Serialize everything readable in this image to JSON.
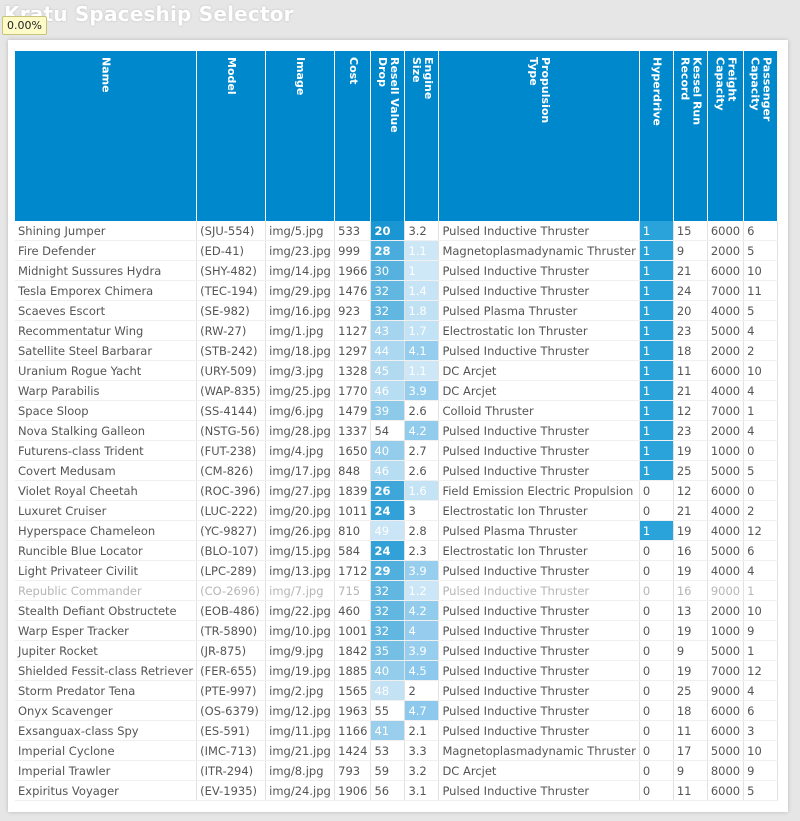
{
  "page": {
    "title": "Kratu Spaceship Selector",
    "progress": "0.00%"
  },
  "columns": [
    "Name",
    "Model",
    "Image",
    "Cost",
    "Resell Value\nDrop",
    "Engine\nSize",
    "Propulsion\nType",
    "Hyperdrive",
    "Kessel Run\nRecord",
    "Freight\nCapacity",
    "Passenger\nCapacity"
  ],
  "colors": {
    "header": "#0088cc",
    "heat_high": "#1a96d2",
    "heat_low": "#cfe8f7"
  },
  "rows": [
    [
      "Shining Jumper",
      "(SJU-554)",
      "img/5.jpg",
      "533",
      "20",
      "3.2",
      "Pulsed Inductive Thruster",
      "1",
      "15",
      "6000",
      "6"
    ],
    [
      "Fire Defender",
      "(ED-41)",
      "img/23.jpg",
      "999",
      "28",
      "1.1",
      "Magnetoplasmadynamic Thruster",
      "1",
      "9",
      "2000",
      "5"
    ],
    [
      "Midnight Sussures Hydra",
      "(SHY-482)",
      "img/14.jpg",
      "1966",
      "30",
      "1",
      "Pulsed Inductive Thruster",
      "1",
      "21",
      "6000",
      "10"
    ],
    [
      "Tesla Emporex Chimera",
      "(TEC-194)",
      "img/29.jpg",
      "1476",
      "32",
      "1.4",
      "Pulsed Inductive Thruster",
      "1",
      "24",
      "7000",
      "11"
    ],
    [
      "Scaeves Escort",
      "(SE-982)",
      "img/16.jpg",
      "923",
      "32",
      "1.8",
      "Pulsed Plasma Thruster",
      "1",
      "20",
      "4000",
      "5"
    ],
    [
      "Recommentatur Wing",
      "(RW-27)",
      "img/1.jpg",
      "1127",
      "43",
      "1.7",
      "Electrostatic Ion Thruster",
      "1",
      "23",
      "5000",
      "4"
    ],
    [
      "Satellite Steel Barbarar",
      "(STB-242)",
      "img/18.jpg",
      "1297",
      "44",
      "4.1",
      "Pulsed Inductive Thruster",
      "1",
      "18",
      "2000",
      "2"
    ],
    [
      "Uranium Rogue Yacht",
      "(URY-509)",
      "img/3.jpg",
      "1328",
      "45",
      "1.1",
      "DC Arcjet",
      "1",
      "11",
      "6000",
      "10"
    ],
    [
      "Warp Parabilis",
      "(WAP-835)",
      "img/25.jpg",
      "1770",
      "46",
      "3.9",
      "DC Arcjet",
      "1",
      "21",
      "4000",
      "4"
    ],
    [
      "Space Sloop",
      "(SS-4144)",
      "img/6.jpg",
      "1479",
      "39",
      "2.6",
      "Colloid Thruster",
      "1",
      "12",
      "7000",
      "1"
    ],
    [
      "Nova Stalking Galleon",
      "(NSTG-56)",
      "img/28.jpg",
      "1337",
      "54",
      "4.2",
      "Pulsed Inductive Thruster",
      "1",
      "23",
      "2000",
      "4"
    ],
    [
      "Futurens-class Trident",
      "(FUT-238)",
      "img/4.jpg",
      "1650",
      "40",
      "2.7",
      "Pulsed Inductive Thruster",
      "1",
      "19",
      "1000",
      "0"
    ],
    [
      "Covert Medusam",
      "(CM-826)",
      "img/17.jpg",
      "848",
      "46",
      "2.6",
      "Pulsed Inductive Thruster",
      "1",
      "25",
      "5000",
      "5"
    ],
    [
      "Violet Royal Cheetah",
      "(ROC-396)",
      "img/27.jpg",
      "1839",
      "26",
      "1.6",
      "Field Emission Electric Propulsion",
      "0",
      "12",
      "6000",
      "0"
    ],
    [
      "Luxuret Cruiser",
      "(LUC-222)",
      "img/20.jpg",
      "1011",
      "24",
      "3",
      "Electrostatic Ion Thruster",
      "0",
      "21",
      "4000",
      "2"
    ],
    [
      "Hyperspace Chameleon",
      "(YC-9827)",
      "img/26.jpg",
      "810",
      "49",
      "2.8",
      "Pulsed Plasma Thruster",
      "1",
      "19",
      "4000",
      "12"
    ],
    [
      "Runcible Blue Locator",
      "(BLO-107)",
      "img/15.jpg",
      "584",
      "24",
      "2.3",
      "Electrostatic Ion Thruster",
      "0",
      "16",
      "5000",
      "6"
    ],
    [
      "Light Privateer Civilit",
      "(LPC-289)",
      "img/13.jpg",
      "1712",
      "29",
      "3.9",
      "Pulsed Inductive Thruster",
      "0",
      "19",
      "4000",
      "4"
    ],
    [
      "Republic Commander",
      "(CO-2696)",
      "img/7.jpg",
      "715",
      "32",
      "1.2",
      "Pulsed Inductive Thruster",
      "0",
      "16",
      "9000",
      "1"
    ],
    [
      "Stealth Defiant Obstructete",
      "(EOB-486)",
      "img/22.jpg",
      "460",
      "32",
      "4.2",
      "Pulsed Inductive Thruster",
      "0",
      "13",
      "2000",
      "10"
    ],
    [
      "Warp Esper Tracker",
      "(TR-5890)",
      "img/10.jpg",
      "1001",
      "32",
      "4",
      "Pulsed Inductive Thruster",
      "0",
      "19",
      "1000",
      "9"
    ],
    [
      "Jupiter Rocket",
      "(JR-875)",
      "img/9.jpg",
      "1842",
      "35",
      "3.9",
      "Pulsed Inductive Thruster",
      "0",
      "9",
      "5000",
      "1"
    ],
    [
      "Shielded Fessit-class Retriever",
      "(FER-655)",
      "img/19.jpg",
      "1885",
      "40",
      "4.5",
      "Pulsed Inductive Thruster",
      "0",
      "19",
      "7000",
      "12"
    ],
    [
      "Storm Predator Tena",
      "(PTE-997)",
      "img/2.jpg",
      "1565",
      "48",
      "2",
      "Pulsed Inductive Thruster",
      "0",
      "25",
      "9000",
      "4"
    ],
    [
      "Onyx Scavenger",
      "(OS-6379)",
      "img/12.jpg",
      "1963",
      "55",
      "4.7",
      "Pulsed Inductive Thruster",
      "0",
      "18",
      "6000",
      "6"
    ],
    [
      "Exsanguax-class Spy",
      "(ES-591)",
      "img/11.jpg",
      "1166",
      "41",
      "2.1",
      "Pulsed Inductive Thruster",
      "0",
      "11",
      "6000",
      "3"
    ],
    [
      "Imperial Cyclone",
      "(IMC-713)",
      "img/21.jpg",
      "1424",
      "53",
      "3.3",
      "Magnetoplasmadynamic Thruster",
      "0",
      "17",
      "5000",
      "10"
    ],
    [
      "Imperial Trawler",
      "(ITR-294)",
      "img/8.jpg",
      "793",
      "59",
      "3.2",
      "DC Arcjet",
      "0",
      "9",
      "8000",
      "9"
    ],
    [
      "Expiritus Voyager",
      "(EV-1935)",
      "img/24.jpg",
      "1906",
      "56",
      "3.1",
      "Pulsed Inductive Thruster",
      "0",
      "11",
      "6000",
      "5"
    ]
  ],
  "dim_rows": [
    18
  ]
}
